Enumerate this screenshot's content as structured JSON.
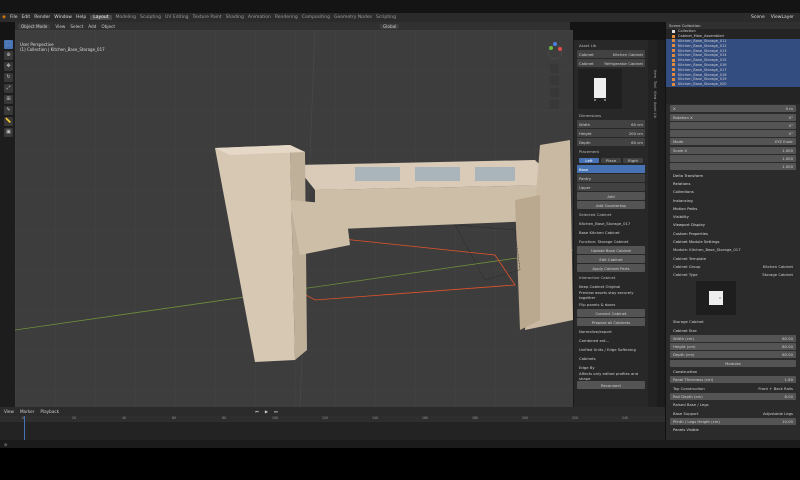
{
  "menu": {
    "items": [
      "File",
      "Edit",
      "Render",
      "Window",
      "Help"
    ],
    "workspaces": [
      "Layout",
      "Modeling",
      "Sculpting",
      "UV Editing",
      "Texture Paint",
      "Shading",
      "Animation",
      "Rendering",
      "Compositing",
      "Geometry Nodes",
      "Scripting"
    ],
    "active_workspace": "Layout",
    "scene": "Scene",
    "view_layer": "ViewLayer"
  },
  "viewport_header": {
    "mode": "Object Mode",
    "menus": [
      "View",
      "Select",
      "Add",
      "Object"
    ],
    "orientation": "Global"
  },
  "viewport_info": {
    "line1": "User Perspective",
    "line2": "(1) Collection | Kitchen_Base_Storage_017"
  },
  "npanel": {
    "title": "Asset Lib",
    "cabinet_label": "Cabinet",
    "cabinet_value": "Kitchen Cabinet",
    "category_label": "Cabinet",
    "category_value": "Refrigerator Cabinet",
    "dimensions_title": "Dimensions",
    "width_label": "Width",
    "width_value": "60 cm",
    "height_label": "Height",
    "height_value": "200 cm",
    "depth_label": "Depth",
    "depth_value": "60 cm",
    "placement_title": "Placement",
    "placement_opts": [
      "Left",
      "Right"
    ],
    "place_btn": "Place",
    "list": [
      "Base",
      "Pantry",
      "Upper"
    ],
    "add_btn": "Add",
    "btn_1": "Add Countertop",
    "btn_2": "Selected Cabinet",
    "obj_name": "Kitchen_Base_Storage_017",
    "field_1": "Base Kitchen Cabinet",
    "field_2": "Function: Storage Cabinet",
    "btn_3": "Update Base Cabinet",
    "btn_4": "Edit Cabinet",
    "btn_5": "Apply Cabinet Parts",
    "section_2": "Interactive Cabinet",
    "check_1": "Keep Cabinet Original",
    "info_1": "Preview assets stay securely together",
    "info_2": "Flip panels & doors",
    "btn_6": "Convert Cabinet",
    "btn_7": "Prepare all Cabinets",
    "info_3": "Normalize/export",
    "info_4": "Combined ext...",
    "check_2": "Unified Units / Edge Softening",
    "info_5": "Cabinets",
    "info_6": "Edge By",
    "info_7": "Affects only edited profiles and shape",
    "btn_8": "Reconnect"
  },
  "side_tabs": [
    "Item",
    "Tool",
    "View",
    "Asset Lib"
  ],
  "outliner": {
    "title": "Scene Collection",
    "collection": "Collection",
    "rows": [
      "Cabinet_Main_Assembled",
      "Kitchen_Base_Storage_011",
      "Kitchen_Base_Storage_012",
      "Kitchen_Base_Storage_013",
      "Kitchen_Base_Storage_014",
      "Kitchen_Base_Storage_015",
      "Kitchen_Base_Storage_016",
      "Kitchen_Base_Storage_017",
      "Kitchen_Base_Storage_018",
      "Kitchen_Base_Storage_019",
      "Kitchen_Base_Storage_020"
    ]
  },
  "properties": {
    "row_x": "X",
    "row_x_value": "0 m",
    "rotation_label": "Rotation X",
    "rotation_value": "0°",
    "row_y_value": "0°",
    "row_z_value": "0°",
    "mode_label": "Mode",
    "mode_value": "XYZ Euler",
    "scale_label": "Scale X",
    "scale_x": "1.000",
    "scale_y": "1.000",
    "scale_z": "1.000",
    "sections": [
      "Delta Transform",
      "Relations",
      "Collections",
      "Instancing",
      "Motion Paths",
      "Visibility",
      "Viewport Display",
      "Custom Properties",
      "Cabinet Module Settings"
    ],
    "module_label": "Module: Kitchen_Base_Storage_017",
    "cabinet_template": "Cabinet Template",
    "group_label": "Cabinet Group",
    "group_value": "Kitchen Cabinet",
    "type_label": "Cabinet Type",
    "type_value": "Storage Cabinet",
    "thumb_caption": "Storage Cabinet",
    "size_title": "Cabinet Size",
    "width_field": "Width (cm)",
    "width_value": "60.00",
    "height_field": "Height (cm)",
    "height_value": "80.00",
    "depth_field": "Depth (cm)",
    "depth_value": "60.00",
    "modules_btn": "Modules",
    "construction_title": "Construction",
    "panel_thickness": "Panel Thickness (cm)",
    "panel_thickness_value": "1.80",
    "top_construction": "Top Construction",
    "top_construction_value": "Front + Back Rails",
    "rail_depth": "Rail Depth (cm)",
    "rail_depth_value": "8.00",
    "raised_base": "Raised Base / Legs",
    "base_support": "Base Support",
    "base_support_value": "Adjustable Legs",
    "plinth": "Plinth / Legs Height (cm)",
    "plinth_value": "10.00",
    "panels_title": "Panels Visible"
  },
  "timeline": {
    "menus": [
      "View",
      "Marker",
      "Playback"
    ],
    "ticks": [
      "0",
      "20",
      "40",
      "60",
      "80",
      "100",
      "120",
      "140",
      "160",
      "180",
      "200",
      "220",
      "240"
    ],
    "current_frame": "1"
  }
}
